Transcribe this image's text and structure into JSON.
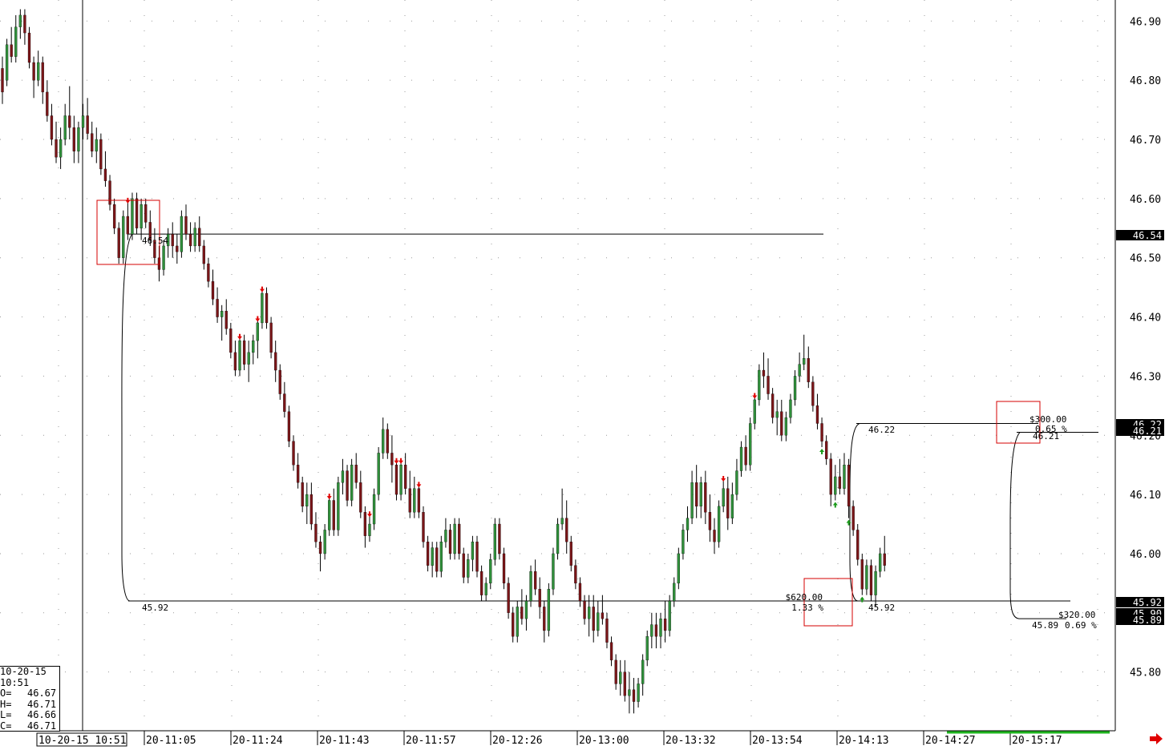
{
  "colors": {
    "up": "#2f8f3a",
    "down": "#7a1518",
    "wick": "#000000",
    "grid": "#9a9a9a",
    "box": "#d40000",
    "volume": "#1fb51f",
    "label_bg": "#000000",
    "label_fg": "#ffffff"
  },
  "chart_data": {
    "type": "candlestick",
    "ylim": [
      45.7,
      46.94
    ],
    "y_ticks": [
      "46.90",
      "46.80",
      "46.70",
      "46.60",
      "46.50",
      "46.40",
      "46.30",
      "46.20",
      "46.10",
      "46.00",
      "45.80"
    ],
    "x_tick_labels": [
      "10-20-15  10:51",
      "20-11:05",
      "20-11:24",
      "20-11:43",
      "20-11:57",
      "20-12:26",
      "20-13:00",
      "20-13:32",
      "20-13:54",
      "20-14:13",
      "20-14:27",
      "20-15:17"
    ],
    "bars": [
      [
        46.82,
        46.84,
        46.76,
        46.78
      ],
      [
        46.8,
        46.87,
        46.79,
        46.86
      ],
      [
        46.86,
        46.89,
        46.83,
        46.84
      ],
      [
        46.84,
        46.91,
        46.83,
        46.89
      ],
      [
        46.89,
        46.92,
        46.87,
        46.91
      ],
      [
        46.91,
        46.92,
        46.86,
        46.88
      ],
      [
        46.88,
        46.89,
        46.82,
        46.83
      ],
      [
        46.83,
        46.84,
        46.77,
        46.8
      ],
      [
        46.8,
        46.85,
        46.79,
        46.83
      ],
      [
        46.83,
        46.84,
        46.76,
        46.78
      ],
      [
        46.78,
        46.8,
        46.73,
        46.74
      ],
      [
        46.74,
        46.76,
        46.69,
        46.7
      ],
      [
        46.7,
        46.73,
        46.66,
        46.67
      ],
      [
        46.67,
        46.72,
        46.65,
        46.7
      ],
      [
        46.7,
        46.76,
        46.69,
        46.74
      ],
      [
        46.74,
        46.79,
        46.7,
        46.72
      ],
      [
        46.72,
        46.74,
        46.66,
        46.68
      ],
      [
        46.68,
        46.73,
        46.66,
        46.72
      ],
      [
        46.72,
        46.76,
        46.7,
        46.74
      ],
      [
        46.74,
        46.77,
        46.7,
        46.71
      ],
      [
        46.71,
        46.73,
        46.67,
        46.68
      ],
      [
        46.68,
        46.72,
        46.66,
        46.7
      ],
      [
        46.7,
        46.71,
        46.64,
        46.65
      ],
      [
        46.65,
        46.68,
        46.62,
        46.63
      ],
      [
        46.63,
        46.64,
        46.58,
        46.59
      ],
      [
        46.59,
        46.6,
        46.54,
        46.55
      ],
      [
        46.55,
        46.56,
        46.49,
        46.5
      ],
      [
        46.5,
        46.58,
        46.49,
        46.57
      ],
      [
        46.57,
        46.6,
        46.53,
        46.54
      ],
      [
        46.54,
        46.61,
        46.53,
        46.6
      ],
      [
        46.6,
        46.61,
        46.54,
        46.55
      ],
      [
        46.55,
        46.6,
        46.53,
        46.59
      ],
      [
        46.59,
        46.6,
        46.55,
        46.56
      ],
      [
        46.56,
        46.58,
        46.52,
        46.53
      ],
      [
        46.53,
        46.55,
        46.49,
        46.5
      ],
      [
        46.5,
        46.52,
        46.46,
        46.48
      ],
      [
        46.48,
        46.53,
        46.47,
        46.52
      ],
      [
        46.52,
        46.55,
        46.5,
        46.54
      ],
      [
        46.54,
        46.56,
        46.5,
        46.52
      ],
      [
        46.52,
        46.54,
        46.49,
        46.51
      ],
      [
        46.51,
        46.58,
        46.5,
        46.57
      ],
      [
        46.57,
        46.59,
        46.53,
        46.54
      ],
      [
        46.54,
        46.56,
        46.51,
        46.52
      ],
      [
        46.52,
        46.56,
        46.51,
        46.55
      ],
      [
        46.55,
        46.57,
        46.51,
        46.52
      ],
      [
        46.52,
        46.53,
        46.48,
        46.49
      ],
      [
        46.49,
        46.5,
        46.45,
        46.46
      ],
      [
        46.46,
        46.48,
        46.42,
        46.43
      ],
      [
        46.43,
        46.45,
        46.39,
        46.4
      ],
      [
        46.4,
        46.42,
        46.36,
        46.41
      ],
      [
        46.41,
        46.43,
        46.37,
        46.38
      ],
      [
        46.38,
        46.39,
        46.33,
        46.34
      ],
      [
        46.34,
        46.36,
        46.3,
        46.31
      ],
      [
        46.31,
        46.37,
        46.3,
        46.36
      ],
      [
        46.36,
        46.37,
        46.31,
        46.32
      ],
      [
        46.32,
        46.36,
        46.29,
        46.34
      ],
      [
        46.34,
        46.37,
        46.32,
        46.36
      ],
      [
        46.36,
        46.4,
        46.33,
        46.39
      ],
      [
        46.39,
        46.45,
        46.38,
        46.44
      ],
      [
        46.44,
        46.45,
        46.38,
        46.39
      ],
      [
        46.39,
        46.4,
        46.33,
        46.34
      ],
      [
        46.34,
        46.36,
        46.29,
        46.31
      ],
      [
        46.31,
        46.32,
        46.26,
        46.27
      ],
      [
        46.27,
        46.29,
        46.23,
        46.24
      ],
      [
        46.24,
        46.25,
        46.18,
        46.19
      ],
      [
        46.19,
        46.2,
        46.14,
        46.15
      ],
      [
        46.15,
        46.17,
        46.11,
        46.12
      ],
      [
        46.12,
        46.13,
        46.07,
        46.08
      ],
      [
        46.08,
        46.12,
        46.05,
        46.1
      ],
      [
        46.1,
        46.12,
        46.04,
        46.05
      ],
      [
        46.05,
        46.07,
        46.01,
        46.02
      ],
      [
        46.02,
        46.03,
        45.97,
        46.0
      ],
      [
        46.0,
        46.05,
        45.99,
        46.04
      ],
      [
        46.04,
        46.1,
        46.03,
        46.09
      ],
      [
        46.09,
        46.11,
        46.03,
        46.04
      ],
      [
        46.04,
        46.13,
        46.03,
        46.12
      ],
      [
        46.12,
        46.16,
        46.1,
        46.14
      ],
      [
        46.14,
        46.15,
        46.08,
        46.09
      ],
      [
        46.09,
        46.16,
        46.08,
        46.15
      ],
      [
        46.15,
        46.17,
        46.11,
        46.12
      ],
      [
        46.12,
        46.14,
        46.06,
        46.07
      ],
      [
        46.07,
        46.08,
        46.01,
        46.03
      ],
      [
        46.03,
        46.07,
        46.02,
        46.05
      ],
      [
        46.05,
        46.11,
        46.04,
        46.1
      ],
      [
        46.1,
        46.18,
        46.09,
        46.17
      ],
      [
        46.17,
        46.23,
        46.16,
        46.21
      ],
      [
        46.21,
        46.22,
        46.16,
        46.17
      ],
      [
        46.17,
        46.2,
        46.12,
        46.15
      ],
      [
        46.15,
        46.16,
        46.09,
        46.1
      ],
      [
        46.1,
        46.16,
        46.09,
        46.15
      ],
      [
        46.15,
        46.17,
        46.1,
        46.11
      ],
      [
        46.11,
        46.14,
        46.06,
        46.07
      ],
      [
        46.07,
        46.13,
        46.06,
        46.11
      ],
      [
        46.11,
        46.12,
        46.06,
        46.07
      ],
      [
        46.07,
        46.08,
        46.01,
        46.02
      ],
      [
        46.02,
        46.03,
        45.97,
        45.98
      ],
      [
        45.98,
        46.02,
        45.96,
        46.01
      ],
      [
        46.01,
        46.02,
        45.96,
        45.97
      ],
      [
        45.97,
        46.03,
        45.96,
        46.02
      ],
      [
        46.02,
        46.06,
        46.01,
        46.04
      ],
      [
        46.04,
        46.05,
        45.99,
        46.0
      ],
      [
        46.0,
        46.06,
        45.99,
        46.05
      ],
      [
        46.05,
        46.06,
        45.99,
        46.0
      ],
      [
        46.0,
        46.01,
        45.95,
        45.96
      ],
      [
        45.96,
        46.0,
        45.95,
        45.99
      ],
      [
        45.99,
        46.03,
        45.97,
        46.02
      ],
      [
        46.02,
        46.03,
        45.96,
        45.97
      ],
      [
        45.97,
        45.98,
        45.92,
        45.93
      ],
      [
        45.93,
        45.96,
        45.92,
        45.95
      ],
      [
        45.95,
        46.0,
        45.94,
        45.99
      ],
      [
        45.99,
        46.06,
        45.98,
        46.05
      ],
      [
        46.05,
        46.06,
        45.99,
        46.0
      ],
      [
        46.0,
        46.01,
        45.94,
        45.95
      ],
      [
        45.95,
        45.96,
        45.89,
        45.9
      ],
      [
        45.9,
        45.91,
        45.85,
        45.86
      ],
      [
        45.86,
        45.92,
        45.85,
        45.91
      ],
      [
        45.91,
        45.94,
        45.88,
        45.89
      ],
      [
        45.89,
        45.93,
        45.87,
        45.92
      ],
      [
        45.92,
        45.98,
        45.91,
        45.97
      ],
      [
        45.97,
        45.99,
        45.93,
        45.94
      ],
      [
        45.94,
        45.96,
        45.89,
        45.91
      ],
      [
        45.91,
        45.92,
        45.85,
        45.87
      ],
      [
        45.87,
        45.95,
        45.86,
        45.94
      ],
      [
        45.94,
        46.01,
        45.93,
        46.0
      ],
      [
        46.0,
        46.06,
        45.99,
        46.05
      ],
      [
        46.05,
        46.11,
        46.04,
        46.06
      ],
      [
        46.06,
        46.09,
        46.0,
        46.02
      ],
      [
        46.02,
        46.03,
        45.97,
        45.98
      ],
      [
        45.98,
        45.99,
        45.94,
        45.95
      ],
      [
        45.95,
        45.96,
        45.91,
        45.92
      ],
      [
        45.92,
        45.93,
        45.88,
        45.89
      ],
      [
        45.89,
        45.93,
        45.86,
        45.91
      ],
      [
        45.91,
        45.93,
        45.85,
        45.87
      ],
      [
        45.87,
        45.92,
        45.86,
        45.9
      ],
      [
        45.9,
        45.93,
        45.88,
        45.89
      ],
      [
        45.89,
        45.9,
        45.84,
        45.85
      ],
      [
        45.85,
        45.86,
        45.81,
        45.82
      ],
      [
        45.82,
        45.83,
        45.77,
        45.78
      ],
      [
        45.78,
        45.82,
        45.76,
        45.8
      ],
      [
        45.8,
        45.82,
        45.75,
        45.76
      ],
      [
        45.76,
        45.8,
        45.73,
        45.77
      ],
      [
        45.77,
        45.79,
        45.73,
        45.75
      ],
      [
        45.75,
        45.79,
        45.74,
        45.78
      ],
      [
        45.78,
        45.83,
        45.76,
        45.82
      ],
      [
        45.82,
        45.87,
        45.81,
        45.86
      ],
      [
        45.86,
        45.9,
        45.84,
        45.88
      ],
      [
        45.88,
        45.9,
        45.84,
        45.86
      ],
      [
        45.86,
        45.9,
        45.84,
        45.89
      ],
      [
        45.89,
        45.92,
        45.85,
        45.87
      ],
      [
        45.87,
        45.93,
        45.86,
        45.92
      ],
      [
        45.92,
        45.96,
        45.91,
        45.95
      ],
      [
        45.95,
        46.01,
        45.94,
        46.0
      ],
      [
        46.0,
        46.05,
        45.99,
        46.04
      ],
      [
        46.04,
        46.08,
        46.02,
        46.06
      ],
      [
        46.06,
        46.14,
        46.05,
        46.12
      ],
      [
        46.12,
        46.15,
        46.06,
        46.08
      ],
      [
        46.08,
        46.13,
        46.06,
        46.12
      ],
      [
        46.12,
        46.14,
        46.05,
        46.07
      ],
      [
        46.07,
        46.1,
        46.02,
        46.04
      ],
      [
        46.04,
        46.06,
        46.0,
        46.02
      ],
      [
        46.02,
        46.09,
        46.01,
        46.08
      ],
      [
        46.08,
        46.13,
        46.07,
        46.11
      ],
      [
        46.11,
        46.13,
        46.04,
        46.06
      ],
      [
        46.06,
        46.12,
        46.05,
        46.1
      ],
      [
        46.1,
        46.16,
        46.09,
        46.14
      ],
      [
        46.14,
        46.19,
        46.13,
        46.18
      ],
      [
        46.18,
        46.2,
        46.14,
        46.15
      ],
      [
        46.15,
        46.23,
        46.14,
        46.22
      ],
      [
        46.22,
        46.27,
        46.21,
        46.26
      ],
      [
        46.26,
        46.32,
        46.25,
        46.31
      ],
      [
        46.31,
        46.34,
        46.28,
        46.3
      ],
      [
        46.3,
        46.33,
        46.26,
        46.27
      ],
      [
        46.27,
        46.28,
        46.22,
        46.23
      ],
      [
        46.23,
        46.26,
        46.2,
        46.24
      ],
      [
        46.24,
        46.26,
        46.19,
        46.2
      ],
      [
        46.2,
        46.24,
        46.19,
        46.23
      ],
      [
        46.23,
        46.27,
        46.22,
        46.26
      ],
      [
        46.26,
        46.31,
        46.25,
        46.3
      ],
      [
        46.3,
        46.34,
        46.29,
        46.32
      ],
      [
        46.32,
        46.37,
        46.31,
        46.33
      ],
      [
        46.33,
        46.35,
        46.28,
        46.29
      ],
      [
        46.29,
        46.3,
        46.24,
        46.25
      ],
      [
        46.25,
        46.27,
        46.21,
        46.22
      ],
      [
        46.22,
        46.23,
        46.18,
        46.19
      ],
      [
        46.19,
        46.2,
        46.15,
        46.16
      ],
      [
        46.16,
        46.17,
        46.08,
        46.1
      ],
      [
        46.1,
        46.15,
        46.09,
        46.13
      ],
      [
        46.13,
        46.16,
        46.1,
        46.11
      ],
      [
        46.11,
        46.17,
        46.1,
        46.15
      ],
      [
        46.15,
        46.16,
        46.06,
        46.08
      ],
      [
        46.08,
        46.09,
        46.03,
        46.04
      ],
      [
        46.04,
        46.05,
        45.98,
        45.99
      ],
      [
        45.99,
        46.0,
        45.93,
        45.94
      ],
      [
        45.94,
        45.99,
        45.93,
        45.98
      ],
      [
        45.98,
        45.99,
        45.92,
        45.93
      ],
      [
        45.93,
        45.98,
        45.91,
        45.97
      ],
      [
        45.97,
        46.01,
        45.96,
        46.0
      ],
      [
        46.0,
        46.03,
        45.97,
        45.98
      ]
    ],
    "horizontal_lines": [
      46.54,
      45.92,
      46.22,
      46.205
    ],
    "level_labels": [
      {
        "text": "46.54",
        "value": 46.54
      },
      {
        "text": "45.92",
        "value": 45.92
      },
      {
        "text": "46.22",
        "value": 46.22
      },
      {
        "text": "45.92",
        "value": 45.92
      },
      {
        "text": "46.21",
        "value": 46.21
      },
      {
        "text": "45.89",
        "value": 45.89
      }
    ],
    "trade_annotations": [
      {
        "amount": "$620.00",
        "percent": "1.33 %"
      },
      {
        "amount": "$300.00",
        "percent": "0.65 %"
      },
      {
        "amount": "$320.00",
        "percent": "0.69 %"
      }
    ],
    "price_tags": [
      "46.54",
      "46.22",
      "46.21",
      "45.92",
      "45.90",
      "45.89"
    ],
    "info_box": {
      "date": "10-20-15",
      "time": "10:51",
      "rows": [
        {
          "label": "O=",
          "value": "46.67"
        },
        {
          "label": "H=",
          "value": "46.71"
        },
        {
          "label": "L=",
          "value": "46.66"
        },
        {
          "label": "C=",
          "value": "46.71"
        }
      ]
    }
  }
}
